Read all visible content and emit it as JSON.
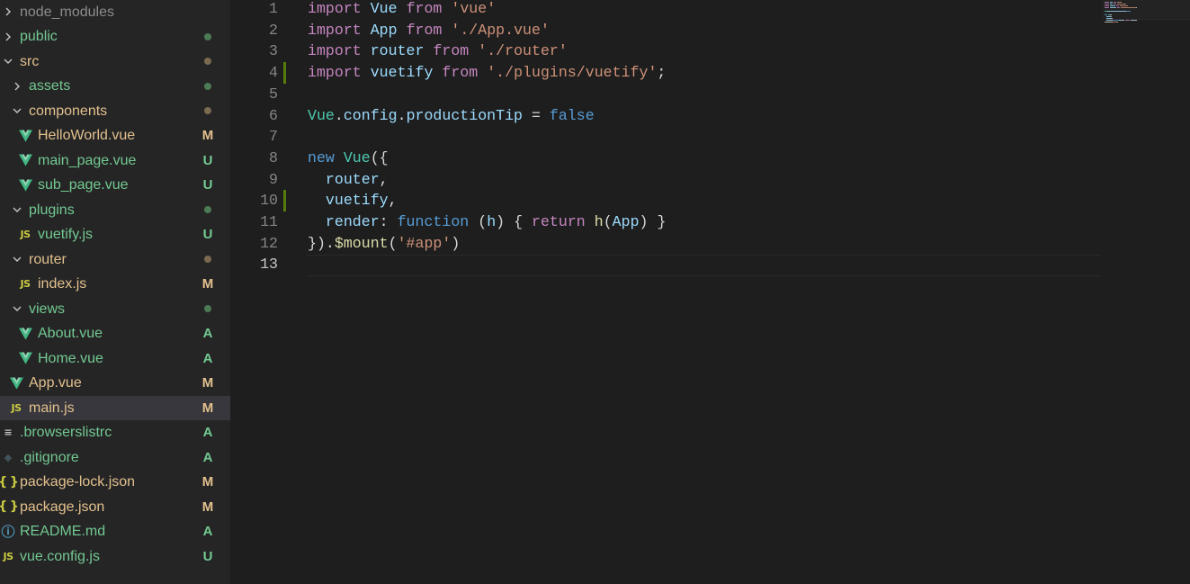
{
  "explorer": {
    "items": [
      {
        "label": "node_modules",
        "kind": "folder",
        "state": "collapsed",
        "depth": 0,
        "color": "#8c8c8c",
        "status": ""
      },
      {
        "label": "public",
        "kind": "folder",
        "state": "collapsed",
        "depth": 0,
        "color": "#73c991",
        "status": "dot",
        "status_color": "#4b7a55"
      },
      {
        "label": "src",
        "kind": "folder",
        "state": "expanded",
        "depth": 0,
        "color": "#e2c08d",
        "status": "dot",
        "status_color": "#7a6a4f"
      },
      {
        "label": "assets",
        "kind": "folder",
        "state": "collapsed",
        "depth": 1,
        "color": "#73c991",
        "status": "dot",
        "status_color": "#4b7a55"
      },
      {
        "label": "components",
        "kind": "folder",
        "state": "expanded",
        "depth": 1,
        "color": "#e2c08d",
        "status": "dot",
        "status_color": "#7a6a4f"
      },
      {
        "label": "HelloWorld.vue",
        "kind": "vue",
        "depth": 2,
        "color": "#e2c08d",
        "status": "M",
        "status_color": "#e2c08d"
      },
      {
        "label": "main_page.vue",
        "kind": "vue",
        "depth": 2,
        "color": "#73c991",
        "status": "U",
        "status_color": "#73c991"
      },
      {
        "label": "sub_page.vue",
        "kind": "vue",
        "depth": 2,
        "color": "#73c991",
        "status": "U",
        "status_color": "#73c991"
      },
      {
        "label": "plugins",
        "kind": "folder",
        "state": "expanded",
        "depth": 1,
        "color": "#73c991",
        "status": "dot",
        "status_color": "#4b7a55"
      },
      {
        "label": "vuetify.js",
        "kind": "js",
        "depth": 2,
        "color": "#73c991",
        "status": "U",
        "status_color": "#73c991"
      },
      {
        "label": "router",
        "kind": "folder",
        "state": "expanded",
        "depth": 1,
        "color": "#e2c08d",
        "status": "dot",
        "status_color": "#7a6a4f"
      },
      {
        "label": "index.js",
        "kind": "js",
        "depth": 2,
        "color": "#e2c08d",
        "status": "M",
        "status_color": "#e2c08d"
      },
      {
        "label": "views",
        "kind": "folder",
        "state": "expanded",
        "depth": 1,
        "color": "#73c991",
        "status": "dot",
        "status_color": "#4b7a55"
      },
      {
        "label": "About.vue",
        "kind": "vue",
        "depth": 2,
        "color": "#73c991",
        "status": "A",
        "status_color": "#73c991"
      },
      {
        "label": "Home.vue",
        "kind": "vue",
        "depth": 2,
        "color": "#73c991",
        "status": "A",
        "status_color": "#73c991"
      },
      {
        "label": "App.vue",
        "kind": "vue",
        "depth": 1,
        "color": "#e2c08d",
        "status": "M",
        "status_color": "#e2c08d"
      },
      {
        "label": "main.js",
        "kind": "js",
        "depth": 1,
        "color": "#e2c08d",
        "status": "M",
        "status_color": "#e2c08d",
        "selected": true
      },
      {
        "label": ".browserslistrc",
        "kind": "lines",
        "depth": 0,
        "color": "#73c991",
        "status": "A",
        "status_color": "#73c991"
      },
      {
        "label": ".gitignore",
        "kind": "git",
        "depth": 0,
        "color": "#73c991",
        "status": "A",
        "status_color": "#73c991"
      },
      {
        "label": "package-lock.json",
        "kind": "json",
        "depth": 0,
        "color": "#e2c08d",
        "status": "M",
        "status_color": "#e2c08d"
      },
      {
        "label": "package.json",
        "kind": "json",
        "depth": 0,
        "color": "#e2c08d",
        "status": "M",
        "status_color": "#e2c08d"
      },
      {
        "label": "README.md",
        "kind": "info",
        "depth": 0,
        "color": "#73c991",
        "status": "A",
        "status_color": "#73c991"
      },
      {
        "label": "vue.config.js",
        "kind": "js",
        "depth": 0,
        "color": "#73c991",
        "status": "U",
        "status_color": "#73c991"
      }
    ]
  },
  "editor": {
    "active_line": 13,
    "modified_lines": [
      4,
      10
    ],
    "lines": [
      {
        "n": "1",
        "tokens": [
          [
            "kw",
            "import"
          ],
          [
            "plain",
            " "
          ],
          [
            "var",
            "Vue"
          ],
          [
            "plain",
            " "
          ],
          [
            "kw",
            "from"
          ],
          [
            "plain",
            " "
          ],
          [
            "str",
            "'vue'"
          ]
        ]
      },
      {
        "n": "2",
        "tokens": [
          [
            "kw",
            "import"
          ],
          [
            "plain",
            " "
          ],
          [
            "var",
            "App"
          ],
          [
            "plain",
            " "
          ],
          [
            "kw",
            "from"
          ],
          [
            "plain",
            " "
          ],
          [
            "str",
            "'./App.vue'"
          ]
        ]
      },
      {
        "n": "3",
        "tokens": [
          [
            "kw",
            "import"
          ],
          [
            "plain",
            " "
          ],
          [
            "var",
            "router"
          ],
          [
            "plain",
            " "
          ],
          [
            "kw",
            "from"
          ],
          [
            "plain",
            " "
          ],
          [
            "str",
            "'./router'"
          ]
        ]
      },
      {
        "n": "4",
        "tokens": [
          [
            "kw",
            "import"
          ],
          [
            "plain",
            " "
          ],
          [
            "var",
            "vuetify"
          ],
          [
            "plain",
            " "
          ],
          [
            "kw",
            "from"
          ],
          [
            "plain",
            " "
          ],
          [
            "str",
            "'./plugins/vuetify'"
          ],
          [
            "plain",
            ";"
          ]
        ]
      },
      {
        "n": "5",
        "tokens": []
      },
      {
        "n": "6",
        "tokens": [
          [
            "cls",
            "Vue"
          ],
          [
            "plain",
            "."
          ],
          [
            "var",
            "config"
          ],
          [
            "plain",
            "."
          ],
          [
            "var",
            "productionTip"
          ],
          [
            "plain",
            " = "
          ],
          [
            "blue",
            "false"
          ]
        ]
      },
      {
        "n": "7",
        "tokens": []
      },
      {
        "n": "8",
        "tokens": [
          [
            "blue",
            "new"
          ],
          [
            "plain",
            " "
          ],
          [
            "cls",
            "Vue"
          ],
          [
            "plain",
            "({"
          ]
        ]
      },
      {
        "n": "9",
        "tokens": [
          [
            "plain",
            "  "
          ],
          [
            "var",
            "router"
          ],
          [
            "plain",
            ","
          ]
        ]
      },
      {
        "n": "10",
        "tokens": [
          [
            "plain",
            "  "
          ],
          [
            "var",
            "vuetify"
          ],
          [
            "plain",
            ","
          ]
        ]
      },
      {
        "n": "11",
        "tokens": [
          [
            "plain",
            "  "
          ],
          [
            "var",
            "render"
          ],
          [
            "plain",
            ": "
          ],
          [
            "blue",
            "function"
          ],
          [
            "plain",
            " ("
          ],
          [
            "var",
            "h"
          ],
          [
            "plain",
            ") { "
          ],
          [
            "kw",
            "return"
          ],
          [
            "plain",
            " "
          ],
          [
            "fn",
            "h"
          ],
          [
            "plain",
            "("
          ],
          [
            "var",
            "App"
          ],
          [
            "plain",
            ") }"
          ]
        ]
      },
      {
        "n": "12",
        "tokens": [
          [
            "plain",
            "})."
          ],
          [
            "fn",
            "$mount"
          ],
          [
            "plain",
            "("
          ],
          [
            "str",
            "'#app'"
          ],
          [
            "plain",
            ")"
          ]
        ]
      },
      {
        "n": "13",
        "tokens": []
      }
    ]
  }
}
